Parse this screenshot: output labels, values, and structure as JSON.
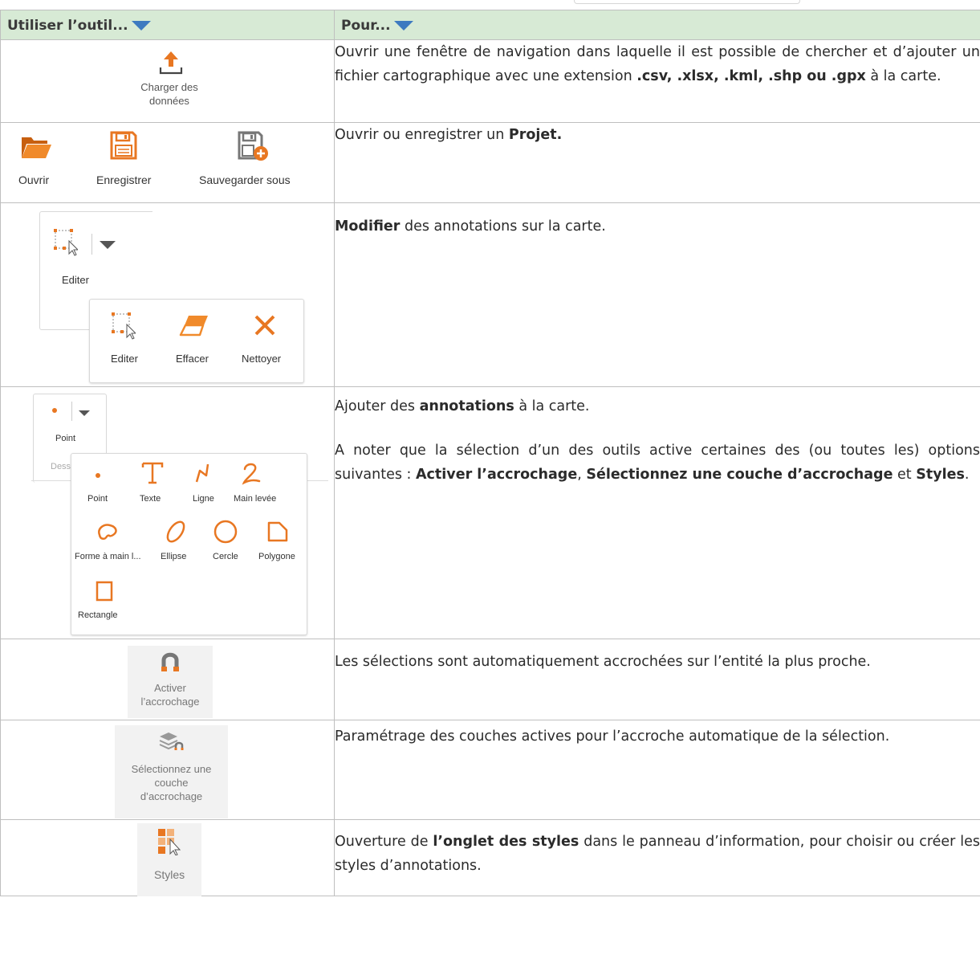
{
  "header": {
    "col1": "Utiliser l’outil...",
    "col2": "Pour..."
  },
  "rows": {
    "load": {
      "tool_label_1": "Charger des",
      "tool_label_2": "données",
      "text_1": "Ouvrir une fenêtre de navigation dans laquelle il est possible de chercher et d’ajouter un fichier cartographique avec une extension ",
      "text_bold": ".csv, .xlsx, .kml, .shp ou .gpx",
      "text_2": " à la carte."
    },
    "project": {
      "open_label": "Ouvrir",
      "save_label": "Enregistrer",
      "saveas_label": "Sauvegarder sous",
      "text_1": "Ouvrir ou enregistrer un ",
      "text_bold": "Projet."
    },
    "edit": {
      "main_label": "Editer",
      "menu": [
        "Editer",
        "Effacer",
        "Nettoyer"
      ],
      "text_bold": "Modifier",
      "text_1": " des annotations sur la carte."
    },
    "draw": {
      "main_label": "Point",
      "group_fragment": "Dess",
      "menu": [
        "Point",
        "Texte",
        "Ligne",
        "Main levée",
        "Forme à main l...",
        "Ellipse",
        "Cercle",
        "Polygone",
        "Rectangle"
      ],
      "p1_a": "Ajouter des ",
      "p1_b": "annotations",
      "p1_c": " à la carte.",
      "p2_a": "A noter que la sélection d’un des outils active certaines des (ou toutes les) options suivantes : ",
      "p2_b": "Activer l’accrochage",
      "p2_c": ", ",
      "p2_d": "Sélectionnez une couche d’accrochage",
      "p2_e": " et ",
      "p2_f": "Styles",
      "p2_g": "."
    },
    "snap": {
      "label_1": "Activer",
      "label_2": "l’accrochage",
      "text": "Les sélections sont automatiquement accrochées sur l’entité la plus proche."
    },
    "snaplayer": {
      "label_1": "Sélectionnez une",
      "label_2": "couche",
      "label_3": "d’accrochage",
      "text": "Paramétrage des couches actives pour l’accroche automatique de la sélection."
    },
    "styles": {
      "label": "Styles",
      "text_1": "Ouverture de ",
      "text_bold": "l’onglet des styles",
      "text_2": " dans le panneau d’information, pour choisir ou créer les styles d’annotations."
    }
  },
  "colors": {
    "header_bg": "#d7ead5",
    "accent_orange": "#e87722",
    "triangle_blue": "#3d7ac0",
    "grid": "#bfbfbf"
  }
}
